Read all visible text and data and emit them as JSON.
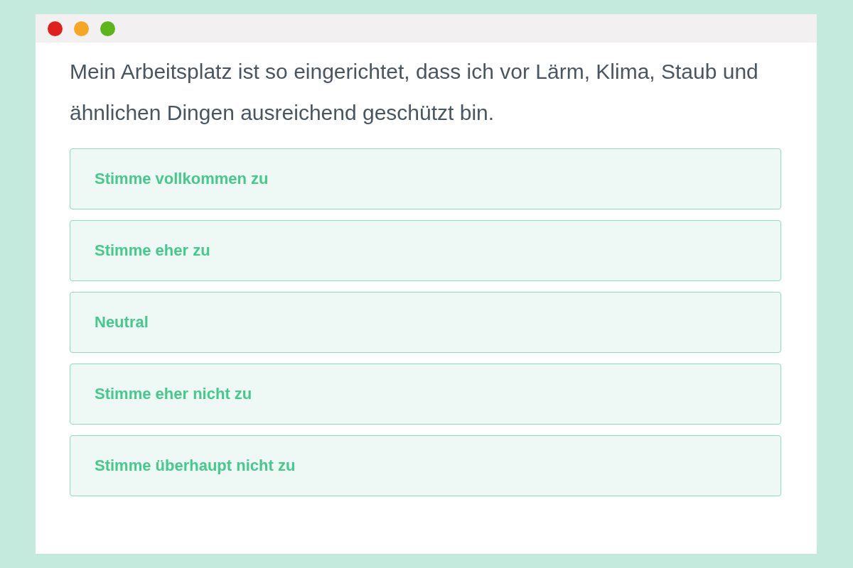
{
  "question": "Mein Arbeitsplatz ist so eingerichtet, dass ich vor Lärm, Klima, Staub und ähnlichen Dingen ausreichend geschützt bin.",
  "options": [
    {
      "label": "Stimme vollkommen zu"
    },
    {
      "label": "Stimme eher zu"
    },
    {
      "label": "Neutral"
    },
    {
      "label": "Stimme eher nicht zu"
    },
    {
      "label": "Stimme überhaupt nicht zu"
    }
  ]
}
